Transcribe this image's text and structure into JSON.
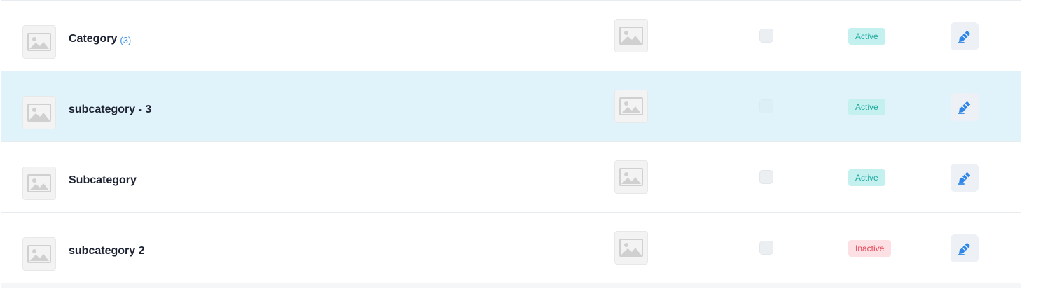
{
  "rows": [
    {
      "name": "Category",
      "count": "(3)",
      "image_icon": "image-placeholder-icon",
      "status": "Active",
      "status_type": "active",
      "edit_icon": "edit-pencil-icon",
      "highlighted": false
    },
    {
      "name": "subcategory - 3",
      "count": "",
      "image_icon": "image-placeholder-icon",
      "status": "Active",
      "status_type": "active",
      "edit_icon": "edit-pencil-icon",
      "highlighted": true
    },
    {
      "name": "Subcategory",
      "count": "",
      "image_icon": "image-placeholder-icon",
      "status": "Active",
      "status_type": "active",
      "edit_icon": "edit-pencil-icon",
      "highlighted": false
    },
    {
      "name": "subcategory 2",
      "count": "",
      "image_icon": "image-placeholder-icon",
      "status": "Inactive",
      "status_type": "inactive",
      "edit_icon": "edit-pencil-icon",
      "highlighted": false
    }
  ],
  "colors": {
    "highlight_row": "#e1f3fa",
    "active_badge_bg": "#c4f1ef",
    "active_badge_text": "#23a8a0",
    "inactive_badge_bg": "#fde0e3",
    "inactive_badge_text": "#e54858",
    "edit_icon": "#2e86e8",
    "count_text": "#3d8fe0"
  }
}
